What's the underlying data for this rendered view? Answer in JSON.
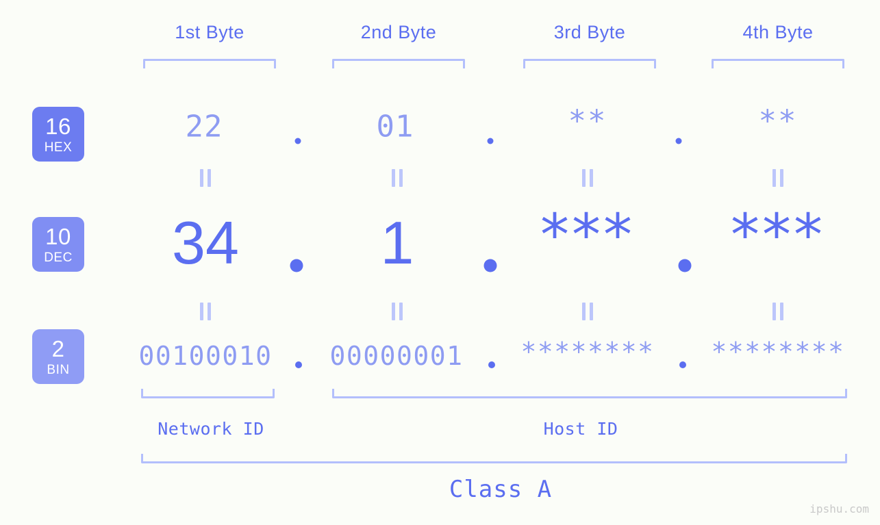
{
  "page": {
    "background_color": "#fbfdf8",
    "accent_color": "#5b6ef0",
    "accent_light_color": "#8e9cf2",
    "bracket_color": "#b3bffc",
    "watermark": "ipshu.com"
  },
  "byte_headers": [
    {
      "label": "1st Byte"
    },
    {
      "label": "2nd Byte"
    },
    {
      "label": "3rd Byte"
    },
    {
      "label": "4th Byte"
    }
  ],
  "bases": [
    {
      "number": "16",
      "name": "HEX",
      "color": "#6c7cf0"
    },
    {
      "number": "10",
      "name": "DEC",
      "color": "#808ef3"
    },
    {
      "number": "2",
      "name": "BIN",
      "color": "#8f9cf5"
    }
  ],
  "rows": {
    "hex": {
      "base_number": "16",
      "base_name": "HEX",
      "values": [
        "22",
        "01",
        "**",
        "**"
      ],
      "separator": "."
    },
    "dec": {
      "base_number": "10",
      "base_name": "DEC",
      "values": [
        "34",
        "1",
        "***",
        "***"
      ],
      "separator": "."
    },
    "bin": {
      "base_number": "2",
      "base_name": "BIN",
      "values": [
        "00100010",
        "00000001",
        "********",
        "********"
      ],
      "separator": "."
    }
  },
  "equality_marks": {
    "symbol": "=",
    "count_per_gap": 4,
    "gaps": [
      "hex-to-dec",
      "dec-to-bin"
    ]
  },
  "sections": [
    {
      "label": "Network ID"
    },
    {
      "label": "Host ID"
    }
  ],
  "class": {
    "label": "Class A"
  }
}
